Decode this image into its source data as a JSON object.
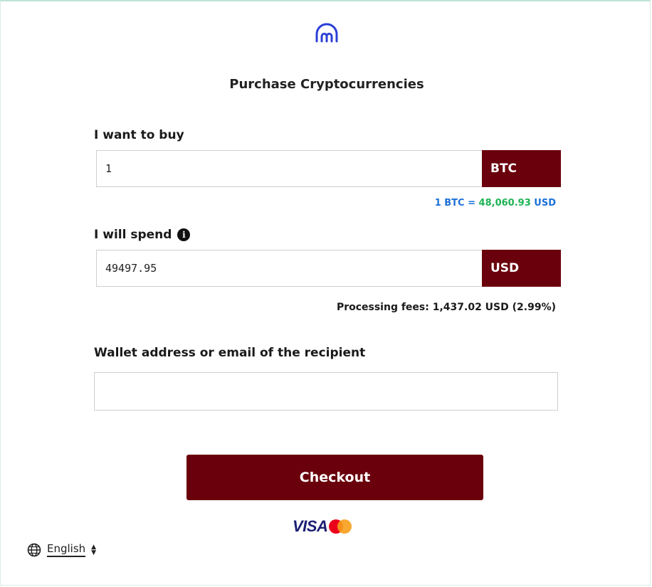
{
  "page_title": "Purchase Cryptocurrencies",
  "buy": {
    "label": "I want to buy",
    "value": "1",
    "currency": "BTC"
  },
  "rate": {
    "left": "1 BTC =",
    "amount": "48,060.93",
    "unit": "USD"
  },
  "spend": {
    "label": "I will spend",
    "value": "49497.95",
    "currency": "USD",
    "info_icon": "info-icon"
  },
  "fees": {
    "text": "Processing fees: 1,437.02 USD (2.99%)"
  },
  "wallet": {
    "label": "Wallet address or email of the recipient",
    "value": "",
    "placeholder": ""
  },
  "checkout": {
    "label": "Checkout"
  },
  "payments": {
    "visa": "VISA",
    "mastercard_icon": "mastercard-icon"
  },
  "language": {
    "label": "English",
    "icon": "globe-icon"
  },
  "colors": {
    "brand": "#6a000b",
    "rate_blue": "#1b6fd6",
    "rate_green": "#1db354",
    "logo_blue": "#2b3fd6"
  }
}
